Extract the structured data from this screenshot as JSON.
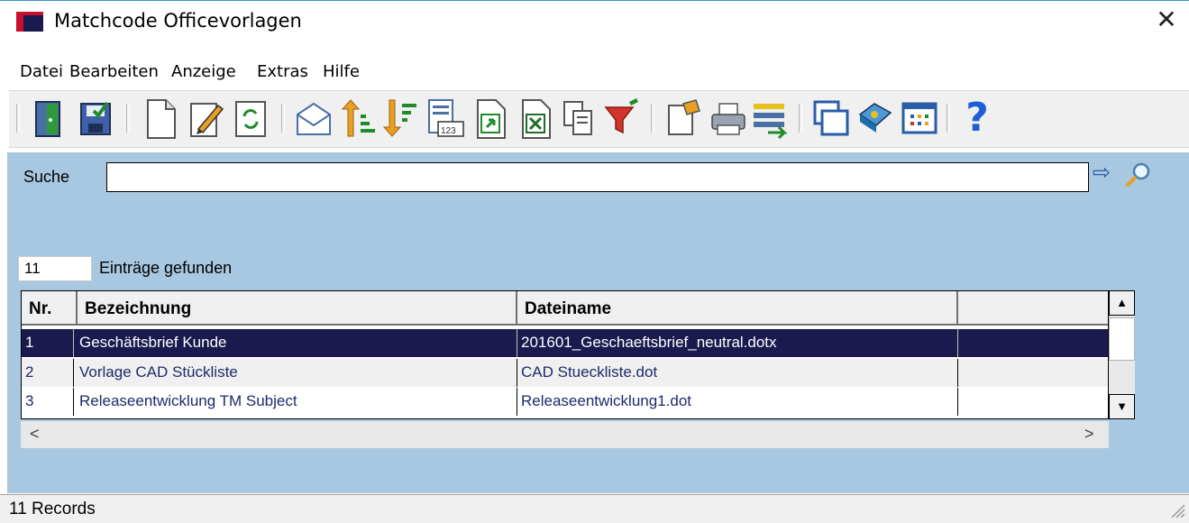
{
  "window": {
    "title": "Matchcode Officevorlagen",
    "close_glyph": "✕"
  },
  "menu": [
    {
      "label": "Datei"
    },
    {
      "label": "Bearbeiten"
    },
    {
      "label": "Anzeige"
    },
    {
      "label": "Extras"
    },
    {
      "label": "Hilfe"
    }
  ],
  "toolbar": {
    "icons": [
      "exit-door-icon",
      "save-icon",
      "new-document-icon",
      "edit-icon",
      "refresh-icon",
      "email-icon",
      "sort-ascending-icon",
      "sort-descending-icon",
      "number-format-icon",
      "export-icon",
      "excel-export-icon",
      "copy-icon",
      "filter-icon",
      "properties-icon",
      "print-icon",
      "list-transfer-icon",
      "windows-icon",
      "book-icon",
      "table-icon",
      "help-icon"
    ],
    "help_glyph": "?"
  },
  "search": {
    "label": "Suche",
    "value": "",
    "go_glyph": "⇨"
  },
  "results": {
    "count": "11",
    "label": "Einträge gefunden"
  },
  "grid": {
    "columns": [
      "Nr.",
      "Bezeichnung",
      "Dateiname",
      ""
    ],
    "rows": [
      {
        "nr": "1",
        "bezeichnung": "Geschäftsbrief Kunde",
        "dateiname": "201601_Geschaeftsbrief_neutral.dotx",
        "selected": true
      },
      {
        "nr": "2",
        "bezeichnung": "Vorlage CAD Stückliste",
        "dateiname": "CAD Stueckliste.dot",
        "selected": false
      },
      {
        "nr": "3",
        "bezeichnung": "Releaseentwicklung TM Subject",
        "dateiname": "Releaseentwicklung1.dot",
        "selected": false
      }
    ],
    "scroll_left": "<",
    "scroll_right": ">",
    "scroll_up": "▲",
    "scroll_down": "▼"
  },
  "status": {
    "text": "11 Records"
  },
  "colors": {
    "selection": "#1b1a4e",
    "background": "#a8c7e0",
    "accent_red": "#c8102e"
  }
}
